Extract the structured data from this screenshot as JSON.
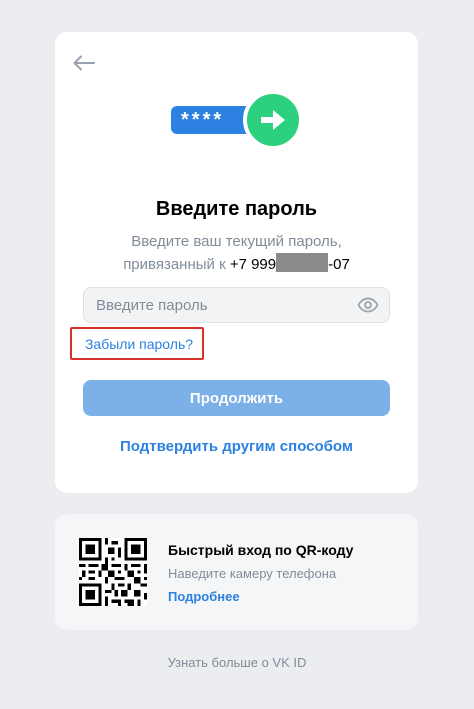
{
  "hero": {
    "masked_password": "****"
  },
  "form": {
    "title": "Введите пароль",
    "subtitle_line1": "Введите ваш текущий пароль,",
    "subtitle_prefix": "привязанный к ",
    "phone_start": "+7 999",
    "phone_end": "-07",
    "password_placeholder": "Введите пароль",
    "forgot_label": "Забыли пароль?",
    "continue_label": "Продолжить",
    "other_method_label": "Подтвердить другим способом"
  },
  "qr": {
    "title": "Быстрый вход по QR-коду",
    "subtitle": "Наведите камеру телефона",
    "more_label": "Подробнее"
  },
  "footer": {
    "learn_more": "Узнать больше о VK ID"
  },
  "colors": {
    "accent": "#2d81e0",
    "button_disabled": "#7cb0e8",
    "hero_green": "#2bd17e",
    "highlight_red": "#d8312b",
    "background": "#ebedf0"
  }
}
